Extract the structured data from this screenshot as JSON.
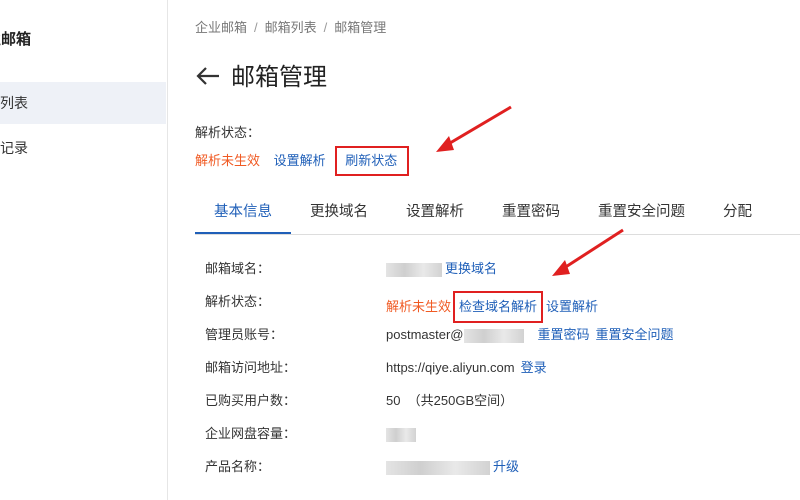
{
  "sidebar": {
    "title": "业邮箱",
    "items": [
      {
        "label": "箱列表",
        "active": true
      },
      {
        "label": "作记录",
        "active": false
      }
    ]
  },
  "breadcrumb": {
    "items": [
      "企业邮箱",
      "邮箱列表",
      "邮箱管理"
    ],
    "separator": "/"
  },
  "page": {
    "back_icon": "left-arrow-icon",
    "title": "邮箱管理"
  },
  "resolve_status": {
    "label": "解析状态：",
    "status": "解析未生效",
    "set_link": "设置解析",
    "refresh_link": "刷新状态"
  },
  "tabs": [
    {
      "label": "基本信息",
      "active": true
    },
    {
      "label": "更换域名",
      "active": false
    },
    {
      "label": "设置解析",
      "active": false
    },
    {
      "label": "重置密码",
      "active": false
    },
    {
      "label": "重置安全问题",
      "active": false
    },
    {
      "label": "分配",
      "active": false
    }
  ],
  "info": {
    "domain": {
      "label": "邮箱域名：",
      "change_link": "更换域名"
    },
    "resolve": {
      "label": "解析状态：",
      "status": "解析未生效",
      "check_link": "检查域名解析",
      "set_link": "设置解析"
    },
    "admin": {
      "label": "管理员账号：",
      "account_prefix": "postmaster@",
      "reset_pw_link": "重置密码",
      "reset_sq_link": "重置安全问题"
    },
    "access": {
      "label": "邮箱访问地址：",
      "url": "https://qiye.aliyun.com",
      "login_link": "登录"
    },
    "users": {
      "label": "已购买用户数：",
      "value": "50  （共250GB空间）"
    },
    "disk": {
      "label": "企业网盘容量："
    },
    "product": {
      "label": "产品名称：",
      "upgrade_link": "升级"
    }
  },
  "colors": {
    "link": "#1f5fb8",
    "warning": "#f05a23",
    "highlight": "#e02020",
    "sidebar_active_bg": "#eef1f7"
  }
}
